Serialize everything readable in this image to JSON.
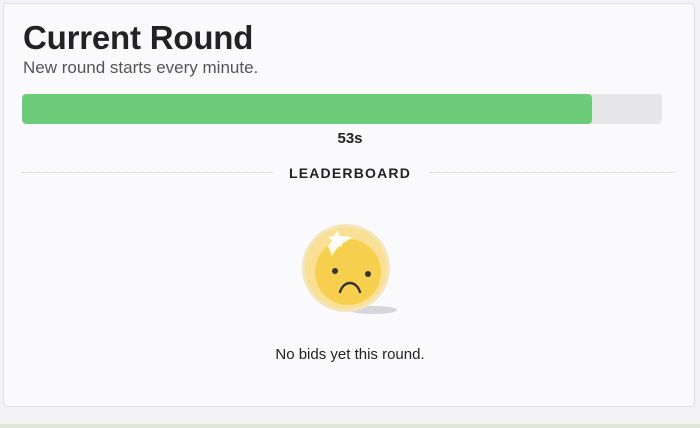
{
  "round": {
    "title": "Current Round",
    "subtitle": "New round starts every minute.",
    "progress_fraction": 0.89,
    "timer_text": "53s"
  },
  "leaderboard": {
    "heading": "LEADERBOARD",
    "empty_message": "No bids yet this round.",
    "empty_icon": "sad-face-icon"
  },
  "colors": {
    "progress_fill": "#6ccc79",
    "progress_track": "#e7e7ea",
    "icon_face": "#f7cf4f"
  }
}
